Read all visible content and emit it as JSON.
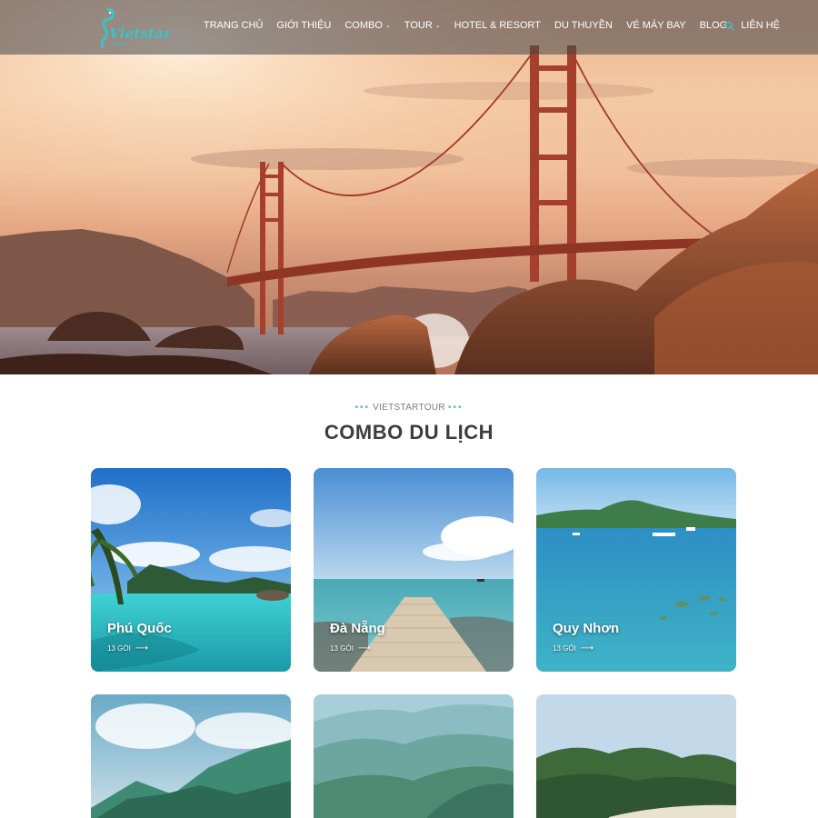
{
  "header": {
    "logo_text": "Vietstar",
    "logo_sub": "TOUR",
    "nav": [
      {
        "label": "TRANG CHỦ",
        "has_dropdown": false
      },
      {
        "label": "GIỚI THIỆU",
        "has_dropdown": false
      },
      {
        "label": "COMBO",
        "has_dropdown": true
      },
      {
        "label": "TOUR",
        "has_dropdown": true
      },
      {
        "label": "HOTEL & RESORT",
        "has_dropdown": false
      },
      {
        "label": "DU THUYỀN",
        "has_dropdown": false
      },
      {
        "label": "VÉ MÁY BAY",
        "has_dropdown": false
      },
      {
        "label": "BLOG",
        "has_dropdown": false
      },
      {
        "label": "LIÊN HỆ",
        "has_dropdown": false
      }
    ],
    "search_icon": "search-icon",
    "accent_color": "#3cc3c8"
  },
  "section": {
    "kicker": "VIETSTARTOUR",
    "title": "COMBO DU LỊCH"
  },
  "combos": [
    {
      "name": "Phú Quốc",
      "count": "13 GÓI"
    },
    {
      "name": "Đà Nẵng",
      "count": "13 GÓI"
    },
    {
      "name": "Quy Nhơn",
      "count": "13 GÓI"
    }
  ]
}
